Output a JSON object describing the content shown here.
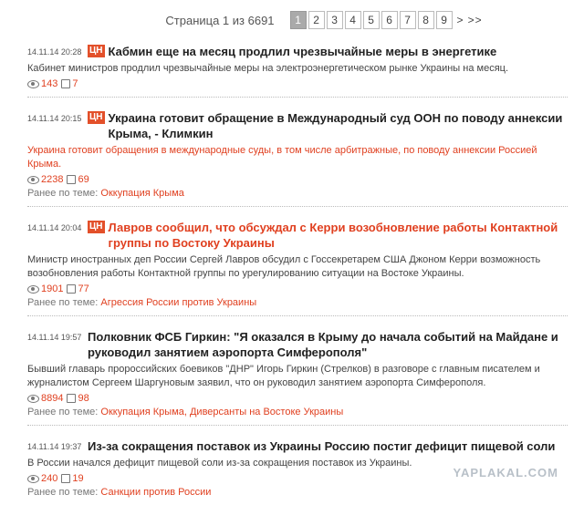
{
  "pager": {
    "label": "Страница 1 из 6691",
    "pages": [
      "1",
      "2",
      "3",
      "4",
      "5",
      "6",
      "7",
      "8",
      "9"
    ],
    "next": ">",
    "last": ">>"
  },
  "themes_prefix": "Ранее по теме:",
  "news": [
    {
      "time": "14.11.14 20:28",
      "tag": "ЦН",
      "title": "Кабмин еще на месяц продлил чрезвычайные меры в энергетике",
      "lead": "Кабинет министров продлил чрезвычайные меры на электроэнергетическом рынке Украины на месяц.",
      "views": "143",
      "comments": "7"
    },
    {
      "time": "14.11.14 20:15",
      "tag": "ЦН",
      "title": "Украина готовит обращение в Международный суд ООН по поводу аннексии Крыма, - Климкин",
      "lead": "Украина готовит обращения в международные суды, в том числе арбитражные, по поводу аннексии Россией Крыма.",
      "views": "2238",
      "comments": "69",
      "themes": "Оккупация Крыма"
    },
    {
      "time": "14.11.14 20:04",
      "tag": "ЦН",
      "title": "Лавров сообщил, что обсуждал с Керри возобновление работы Контактной группы по Востоку Украины",
      "lead": "Министр иностранных деп России Сергей Лавров обсудил с Госсекретарем США Джоном Керри возможность возобновления работы Контактной группы по урегулированию ситуации на Востоке Украины.",
      "views": "1901",
      "comments": "77",
      "themes": "Агрессия России против Украины"
    },
    {
      "time": "14.11.14 19:57",
      "title": "Полковник ФСБ Гиркин: \"Я оказался в Крыму до начала событий на Майдане и руководил занятием аэропорта Симферополя\"",
      "lead": "Бывший главарь пророссийских боевиков \"ДНР\" Игорь Гиркин (Стрелков) в разговоре с главным писателем и журналистом Сергеем Шаргуновым заявил, что он руководил занятием аэропорта Симферополя.",
      "views": "8894",
      "comments": "98",
      "themes": "Оккупация Крыма, Диверсанты на Востоке Украины"
    },
    {
      "time": "14.11.14 19:37",
      "title": "Из-за сокращения поставок из Украины Россию постиг дефицит пищевой соли",
      "lead": "В России начался дефицит пищевой соли из-за сокращения поставок из Украины.",
      "views": "240",
      "comments": "19",
      "themes": "Санкции против России"
    }
  ],
  "watermark": "YAPLAKAL.COM"
}
